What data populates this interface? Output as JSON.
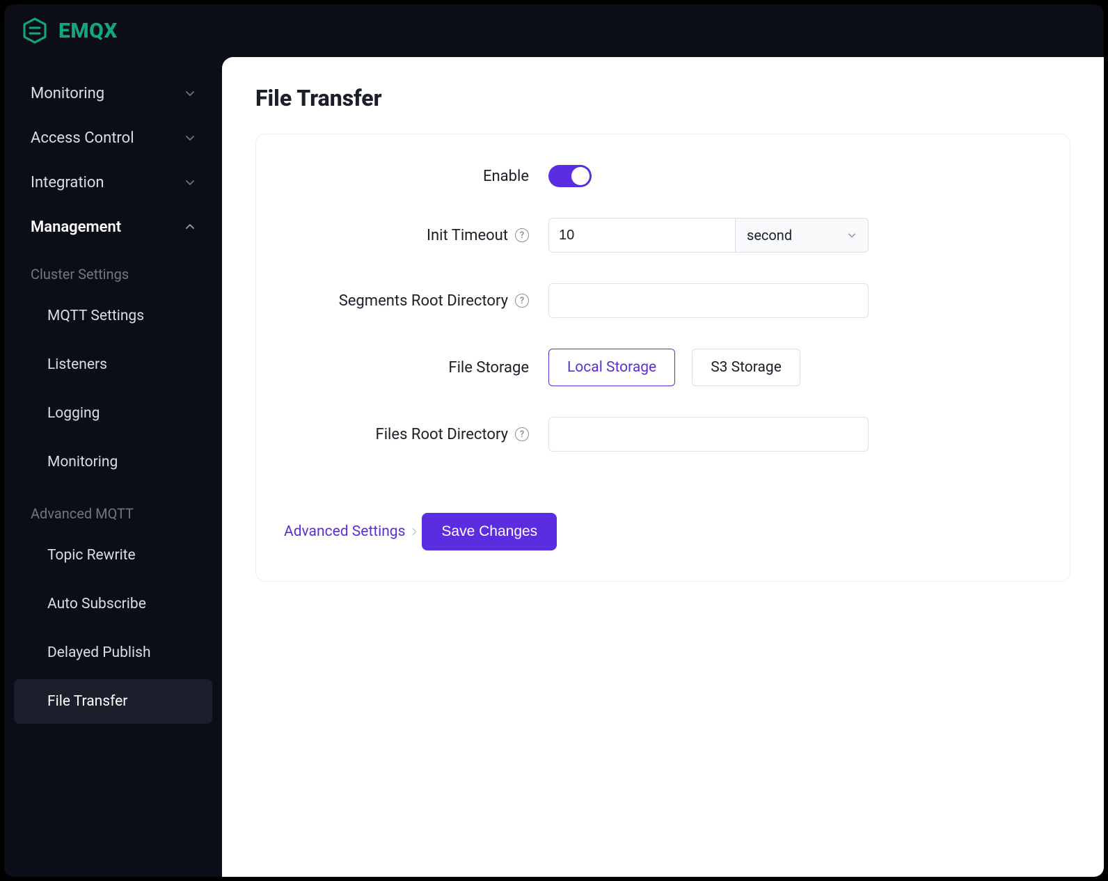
{
  "brand": {
    "name": "EMQX"
  },
  "sidebar": {
    "groups": [
      {
        "label": "Monitoring",
        "expanded": false
      },
      {
        "label": "Access Control",
        "expanded": false
      },
      {
        "label": "Integration",
        "expanded": false
      },
      {
        "label": "Management",
        "expanded": true
      }
    ],
    "sections": [
      {
        "label": "Cluster Settings",
        "items": [
          {
            "label": "MQTT Settings",
            "active": false
          },
          {
            "label": "Listeners",
            "active": false
          },
          {
            "label": "Logging",
            "active": false
          },
          {
            "label": "Monitoring",
            "active": false
          }
        ]
      },
      {
        "label": "Advanced MQTT",
        "items": [
          {
            "label": "Topic Rewrite",
            "active": false
          },
          {
            "label": "Auto Subscribe",
            "active": false
          },
          {
            "label": "Delayed Publish",
            "active": false
          },
          {
            "label": "File Transfer",
            "active": true
          }
        ]
      }
    ]
  },
  "page": {
    "title": "File Transfer",
    "form": {
      "enable_label": "Enable",
      "enable_value": true,
      "init_timeout_label": "Init Timeout",
      "init_timeout_value": "10",
      "init_timeout_unit": "second",
      "segments_root_label": "Segments Root Directory",
      "segments_root_value": "",
      "file_storage_label": "File Storage",
      "file_storage_options": [
        "Local Storage",
        "S3 Storage"
      ],
      "file_storage_selected": "Local Storage",
      "files_root_label": "Files Root Directory",
      "files_root_value": "",
      "advanced_label": "Advanced Settings",
      "save_label": "Save Changes"
    }
  }
}
